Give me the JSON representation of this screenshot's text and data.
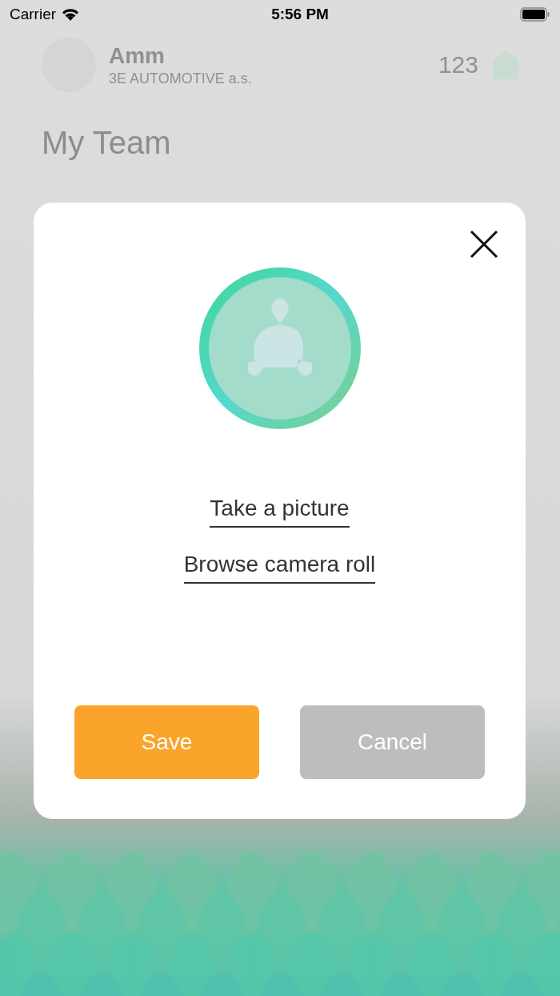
{
  "status_bar": {
    "carrier": "Carrier",
    "time": "5:56 PM"
  },
  "header": {
    "name": "Amm",
    "company": "3E AUTOMOTIVE a.s.",
    "score": "123"
  },
  "page": {
    "title": "My Team"
  },
  "dialog": {
    "options": [
      "Take a picture",
      "Browse camera roll"
    ],
    "buttons": [
      {
        "label": "Save",
        "kind": "primary"
      },
      {
        "label": "Cancel",
        "kind": "secondary"
      }
    ]
  }
}
